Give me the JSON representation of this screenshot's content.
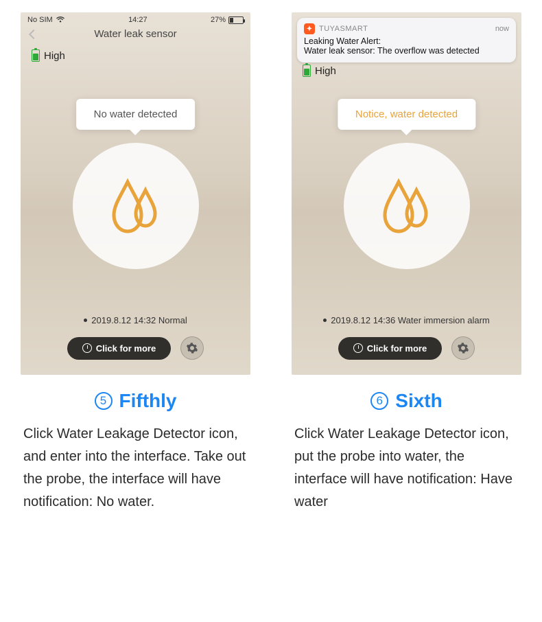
{
  "left": {
    "status": {
      "carrier": "No SIM",
      "time": "14:27",
      "pct": "27%"
    },
    "title": "Water leak sensor",
    "battery": "High",
    "tooltip": "No water detected",
    "log": "2019.8.12 14:32 Normal",
    "more": "Click for more",
    "step_num": "5",
    "step_title": "Fifthly",
    "step_desc": "Click Water Leakage Detector icon, and enter into the interface. Take out the probe, the interface will have notification: No water."
  },
  "right": {
    "notif": {
      "app": "TUYASMART",
      "when": "now",
      "title": "Leaking Water Alert:",
      "body": "Water leak sensor: The overflow was detected"
    },
    "battery": "High",
    "tooltip": "Notice, water detected",
    "log": "2019.8.12 14:36 Water immersion alarm",
    "more": "Click for more",
    "step_num": "6",
    "step_title": "Sixth",
    "step_desc": "Click Water Leakage Detector icon, put the probe into water, the interface will have notification: Have water"
  }
}
